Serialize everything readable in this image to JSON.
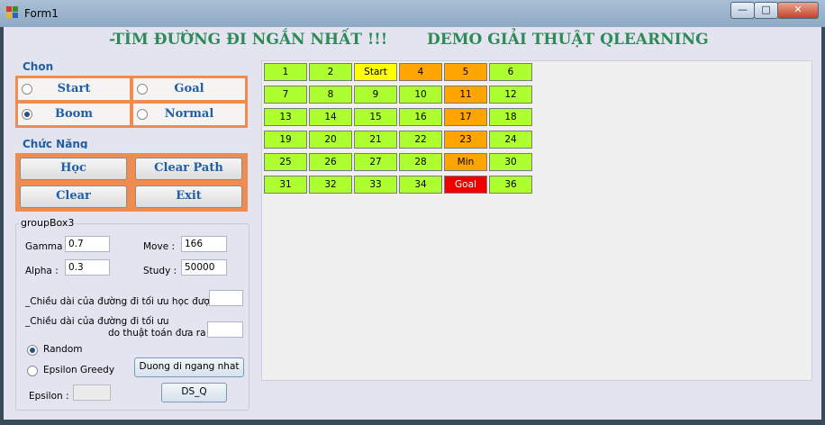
{
  "window": {
    "title": "Form1"
  },
  "header": {
    "left_title": "-TÌM ĐƯỜNG ĐI NGẮN NHẤT !!!",
    "right_title": "DEMO GIẢI THUẬT QLEARNING"
  },
  "chon": {
    "label": "Chọn",
    "options": [
      {
        "label": "Start",
        "checked": false
      },
      {
        "label": "Goal",
        "checked": false
      },
      {
        "label": "Boom",
        "checked": true
      },
      {
        "label": "Normal",
        "checked": false
      }
    ]
  },
  "chuc_nang": {
    "label": "Chức Năng",
    "buttons": [
      "Học",
      "Clear Path",
      "Clear",
      "Exit"
    ]
  },
  "group3": {
    "title": "groupBox3",
    "gamma_label": "Gamma :",
    "gamma_value": "0.7",
    "alpha_label": "Alpha :",
    "alpha_value": "0.3",
    "move_label": "Move :",
    "move_value": "166",
    "study_label": "Study :",
    "study_value": "50000",
    "learned_len_label": "_Chiều dài của đường đi tối ưu học được :",
    "learned_len_value": "",
    "algo_len_label_1": "_Chiều dài của đường đi tối ưu",
    "algo_len_label_2": "do thuật toán đưa ra :",
    "algo_len_value": "",
    "radio_random": "Random",
    "random_checked": true,
    "radio_greedy": "Epsilon Greedy",
    "greedy_checked": false,
    "shortest_button": "Duong di ngang nhat",
    "epsilon_label": "Epsilon :",
    "epsilon_value": "",
    "dsq_button": "DS_Q"
  },
  "colors": {
    "normal": "#adff2f",
    "start": "#ffff00",
    "boom": "#ffa500",
    "goal": "#ee0000"
  },
  "grid": [
    {
      "label": "1",
      "type": "normal"
    },
    {
      "label": "2",
      "type": "normal"
    },
    {
      "label": "Start",
      "type": "start"
    },
    {
      "label": "4",
      "type": "boom"
    },
    {
      "label": "5",
      "type": "boom"
    },
    {
      "label": "6",
      "type": "normal"
    },
    {
      "label": "7",
      "type": "normal"
    },
    {
      "label": "8",
      "type": "normal"
    },
    {
      "label": "9",
      "type": "normal"
    },
    {
      "label": "10",
      "type": "normal"
    },
    {
      "label": "11",
      "type": "boom"
    },
    {
      "label": "12",
      "type": "normal"
    },
    {
      "label": "13",
      "type": "normal"
    },
    {
      "label": "14",
      "type": "normal"
    },
    {
      "label": "15",
      "type": "normal"
    },
    {
      "label": "16",
      "type": "normal"
    },
    {
      "label": "17",
      "type": "boom"
    },
    {
      "label": "18",
      "type": "normal"
    },
    {
      "label": "19",
      "type": "normal"
    },
    {
      "label": "20",
      "type": "normal"
    },
    {
      "label": "21",
      "type": "normal"
    },
    {
      "label": "22",
      "type": "normal"
    },
    {
      "label": "23",
      "type": "boom"
    },
    {
      "label": "24",
      "type": "normal"
    },
    {
      "label": "25",
      "type": "normal"
    },
    {
      "label": "26",
      "type": "normal"
    },
    {
      "label": "27",
      "type": "normal"
    },
    {
      "label": "28",
      "type": "normal"
    },
    {
      "label": "Min",
      "type": "boom"
    },
    {
      "label": "30",
      "type": "normal"
    },
    {
      "label": "31",
      "type": "normal"
    },
    {
      "label": "32",
      "type": "normal"
    },
    {
      "label": "33",
      "type": "normal"
    },
    {
      "label": "34",
      "type": "normal"
    },
    {
      "label": "Goal",
      "type": "goal"
    },
    {
      "label": "36",
      "type": "normal"
    }
  ]
}
